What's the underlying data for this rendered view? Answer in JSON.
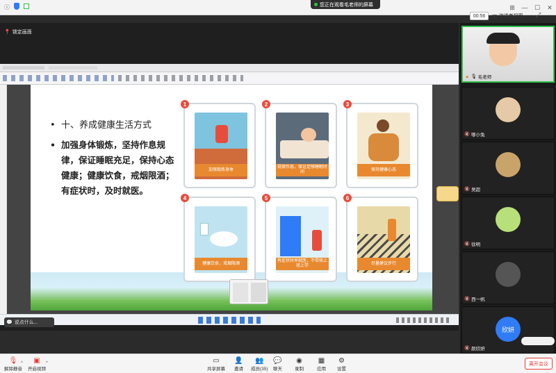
{
  "topbar": {
    "sharing_notice": "您正在观看毛老师的屏幕",
    "timer": "00:56",
    "view_mode": "演讲者视图"
  },
  "stage": {
    "lock_label": "锁定画面",
    "chat_placeholder": "说点什么..."
  },
  "slide": {
    "heading": "十、养成健康生活方式",
    "body": "加强身体锻炼，坚持作息规律，保证睡眠充足，保持心态健康；健康饮食，戒烟限酒；有症状时，及时就医。",
    "panels": [
      {
        "num": "1",
        "caption": "加强锻炼身体"
      },
      {
        "num": "2",
        "caption": "规律作息，保证足够睡眠时间"
      },
      {
        "num": "3",
        "caption": "保持健康心态"
      },
      {
        "num": "4",
        "caption": "健康饮食，戒烟限酒"
      },
      {
        "num": "5",
        "caption": "有症状时早就医，不带病上班上学"
      },
      {
        "num": "6",
        "caption": "尽量建议步行"
      }
    ]
  },
  "gallery": {
    "participants": [
      {
        "name": "毛老师"
      },
      {
        "name": "哪小兔"
      },
      {
        "name": "吴超"
      },
      {
        "name": "徐明"
      },
      {
        "name": "西一帆"
      },
      {
        "name": "颜欣妍",
        "avatar_text": "欣妍"
      }
    ]
  },
  "bottombar": {
    "mute": "解除静音",
    "video": "开启视频",
    "share": "共享屏幕",
    "invite": "邀请",
    "members": "成员(35)",
    "chat": "聊天",
    "record": "录制",
    "apps": "应用",
    "settings": "设置",
    "leave": "离开会议"
  },
  "colors": {
    "accent_red": "#e53935",
    "panel_orange": "#e8892f",
    "avatar_blue": "#2f7cf6"
  }
}
